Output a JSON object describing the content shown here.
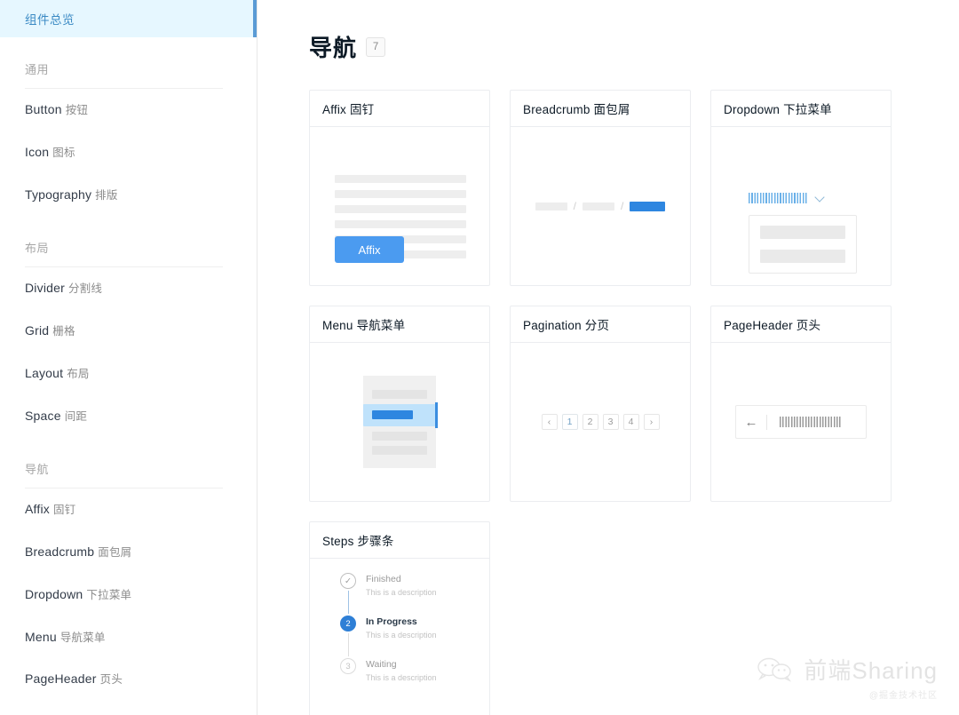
{
  "sidebar": {
    "active_item": "组件总览",
    "sections": [
      {
        "title": "通用",
        "items": [
          {
            "en": "Button",
            "cn": "按钮"
          },
          {
            "en": "Icon",
            "cn": "图标"
          },
          {
            "en": "Typography",
            "cn": "排版"
          }
        ]
      },
      {
        "title": "布局",
        "items": [
          {
            "en": "Divider",
            "cn": "分割线"
          },
          {
            "en": "Grid",
            "cn": "栅格"
          },
          {
            "en": "Layout",
            "cn": "布局"
          },
          {
            "en": "Space",
            "cn": "间距"
          }
        ]
      },
      {
        "title": "导航",
        "items": [
          {
            "en": "Affix",
            "cn": "固钉"
          },
          {
            "en": "Breadcrumb",
            "cn": "面包屑"
          },
          {
            "en": "Dropdown",
            "cn": "下拉菜单"
          },
          {
            "en": "Menu",
            "cn": "导航菜单"
          },
          {
            "en": "PageHeader",
            "cn": "页头"
          }
        ]
      }
    ]
  },
  "main": {
    "title": "导航",
    "badge": "7",
    "cards": [
      {
        "key": "affix",
        "title": "Affix 固钉",
        "demo_button": "Affix"
      },
      {
        "key": "breadcrumb",
        "title": "Breadcrumb 面包屑",
        "separator": "/"
      },
      {
        "key": "dropdown",
        "title": "Dropdown 下拉菜单"
      },
      {
        "key": "menu",
        "title": "Menu 导航菜单"
      },
      {
        "key": "pagination",
        "title": "Pagination 分页",
        "pages": [
          "1",
          "2",
          "3",
          "4"
        ],
        "prev": "‹",
        "next": "›"
      },
      {
        "key": "pageheader",
        "title": "PageHeader 页头",
        "back_arrow": "←"
      },
      {
        "key": "steps",
        "title": "Steps 步骤条",
        "steps": [
          {
            "num": "✓",
            "label": "Finished",
            "desc": "This is a description",
            "state": "done"
          },
          {
            "num": "2",
            "label": "In Progress",
            "desc": "This is a description",
            "state": "active"
          },
          {
            "num": "3",
            "label": "Waiting",
            "desc": "This is a description",
            "state": "wait"
          }
        ]
      }
    ]
  },
  "watermark": {
    "brand": "前端Sharing",
    "handle": "@掘金技术社区"
  },
  "colors": {
    "accent": "#4b9bf0",
    "active_bg": "#e6f7ff",
    "active_bar": "#5a9bd5",
    "border": "#ebedf0",
    "muted_text": "#8c8c8c"
  }
}
